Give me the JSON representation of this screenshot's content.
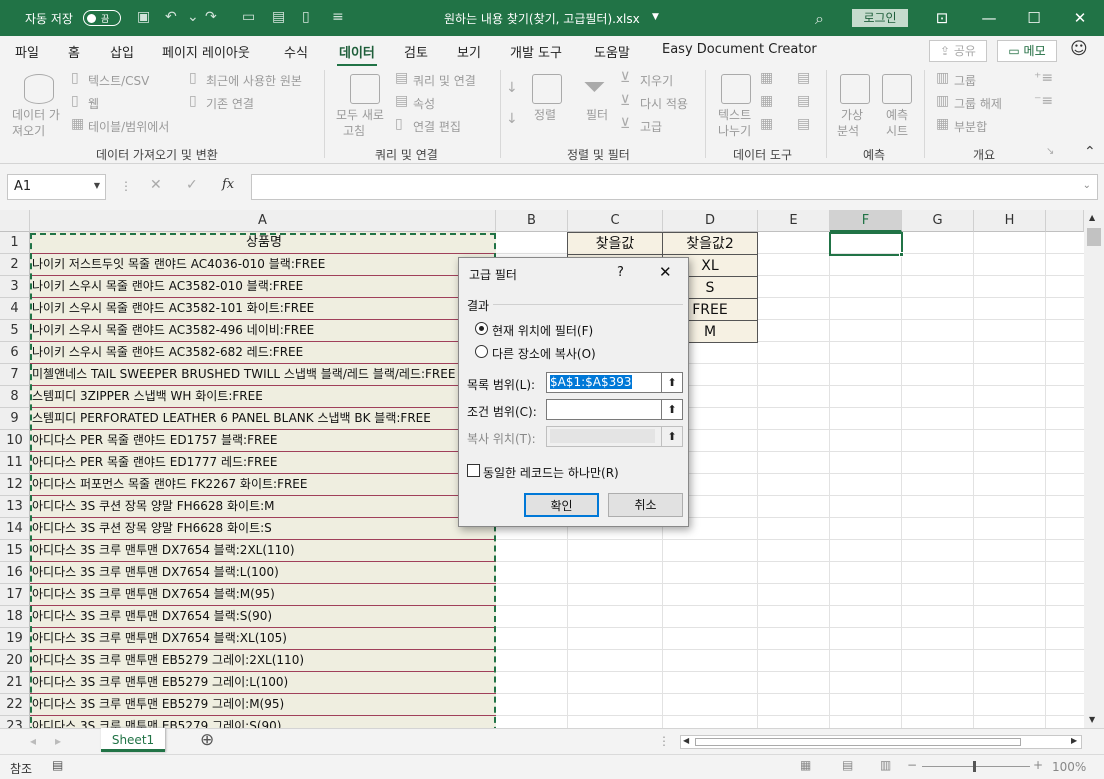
{
  "titlebar": {
    "autosave_label": "자동 저장",
    "autosave_state": "끔",
    "file_title": "원하는 내용 찾기(찾기, 고급필터).xlsx",
    "login": "로그인"
  },
  "tabs": [
    "파일",
    "홈",
    "삽입",
    "페이지 레이아웃",
    "수식",
    "데이터",
    "검토",
    "보기",
    "개발 도구",
    "도움말",
    "Easy Document Creator"
  ],
  "active_tab": "데이터",
  "share": "공유",
  "memo": "메모",
  "ribbon": {
    "get_data": [
      "데이터 가",
      "져오기"
    ],
    "text_csv": "텍스트/CSV",
    "web": "웹",
    "from_table": "테이블/범위에서",
    "recent_sources": "최근에 사용한 원본",
    "existing_conn": "기존 연결",
    "group1": "데이터 가져오기 및 변환",
    "refresh_all": [
      "모두 새로",
      "고침"
    ],
    "queries_conn": "쿼리 및 연결",
    "properties": "속성",
    "edit_links": "연결 편집",
    "group2": "쿼리 및 연결",
    "sort": "정렬",
    "filter": "필터",
    "clear": "지우기",
    "reapply": "다시 적용",
    "advanced": "고급",
    "group3": "정렬 및 필터",
    "text_to_cols": [
      "텍스트",
      "나누기"
    ],
    "group4": "데이터 도구",
    "whatif": [
      "가상",
      "분석"
    ],
    "forecast": [
      "예측",
      "시트"
    ],
    "group5": "예측",
    "group_btn": "그룹",
    "ungroup": "그룹 해제",
    "subtotal": "부분합",
    "group6": "개요"
  },
  "namebox": "A1",
  "fx": "fx",
  "columns": [
    "A",
    "B",
    "C",
    "D",
    "E",
    "F",
    "G",
    "H"
  ],
  "rows": [
    "1",
    "2",
    "3",
    "4",
    "5",
    "6",
    "7",
    "8",
    "9",
    "10",
    "11",
    "12",
    "13",
    "14",
    "15",
    "16",
    "17",
    "18",
    "19",
    "20",
    "21",
    "22",
    "23"
  ],
  "colA": [
    "상품명",
    "나이키 저스트두잇 목줄 랜야드 AC4036-010 블랙:FREE",
    "나이키 스우시 목줄 랜야드 AC3582-010 블랙:FREE",
    "나이키 스우시 목줄 랜야드 AC3582-101 화이트:FREE",
    "나이키 스우시 목줄 랜야드 AC3582-496 네이비:FREE",
    "나이키 스우시 목줄 랜야드 AC3582-682 레드:FREE",
    "미첼앤네스 TAIL SWEEPER BRUSHED TWILL 스냅백 블랙/레드 블랙/레드:FREE",
    "스템피디 3ZIPPER 스냅백 WH 화이트:FREE",
    "스템피디 PERFORATED LEATHER 6 PANEL BLANK 스냅백 BK 블랙:FREE",
    "아디다스 PER 목줄 랜야드 ED1757 블랙:FREE",
    "아디다스 PER 목줄 랜야드 ED1777 레드:FREE",
    "아디다스 퍼포먼스 목줄 랜야드 FK2267 화이트:FREE",
    "아디다스 3S 쿠션 장목 양말 FH6628 화이트:M",
    "아디다스 3S 쿠션 장목 양말 FH6628 화이트:S",
    "아디다스 3S 크루 맨투맨 DX7654 블랙:2XL(110)",
    "아디다스 3S 크루 맨투맨 DX7654 블랙:L(100)",
    "아디다스 3S 크루 맨투맨 DX7654 블랙:M(95)",
    "아디다스 3S 크루 맨투맨 DX7654 블랙:S(90)",
    "아디다스 3S 크루 맨투맨 DX7654 블랙:XL(105)",
    "아디다스 3S 크루 맨투맨 EB5279 그레이:2XL(110)",
    "아디다스 3S 크루 맨투맨 EB5279 그레이:L(100)",
    "아디다스 3S 크루 맨투맨 EB5279 그레이:M(95)",
    "아디다스 3S 크루 맨투맨 EB5279 그레이:S(90)"
  ],
  "criteria": {
    "c_header": "찾을값",
    "d_header": "찾을값2",
    "d_values": [
      "XL",
      "S",
      "FREE",
      "M"
    ]
  },
  "dialog": {
    "title": "고급 필터",
    "help": "?",
    "result_label": "결과",
    "radio_inplace": "현재 위치에 필터(F)",
    "radio_copy": "다른 장소에 복사(O)",
    "list_range_label": "목록 범위(L):",
    "list_range_value": "$A$1:$A$393",
    "criteria_range_label": "조건 범위(C):",
    "copy_to_label": "복사 위치(T):",
    "unique_label": "동일한 레코드는 하나만(R)",
    "ok": "확인",
    "cancel": "취소"
  },
  "sheet_tab": "Sheet1",
  "status": {
    "mode": "참조",
    "zoom": "100%"
  }
}
